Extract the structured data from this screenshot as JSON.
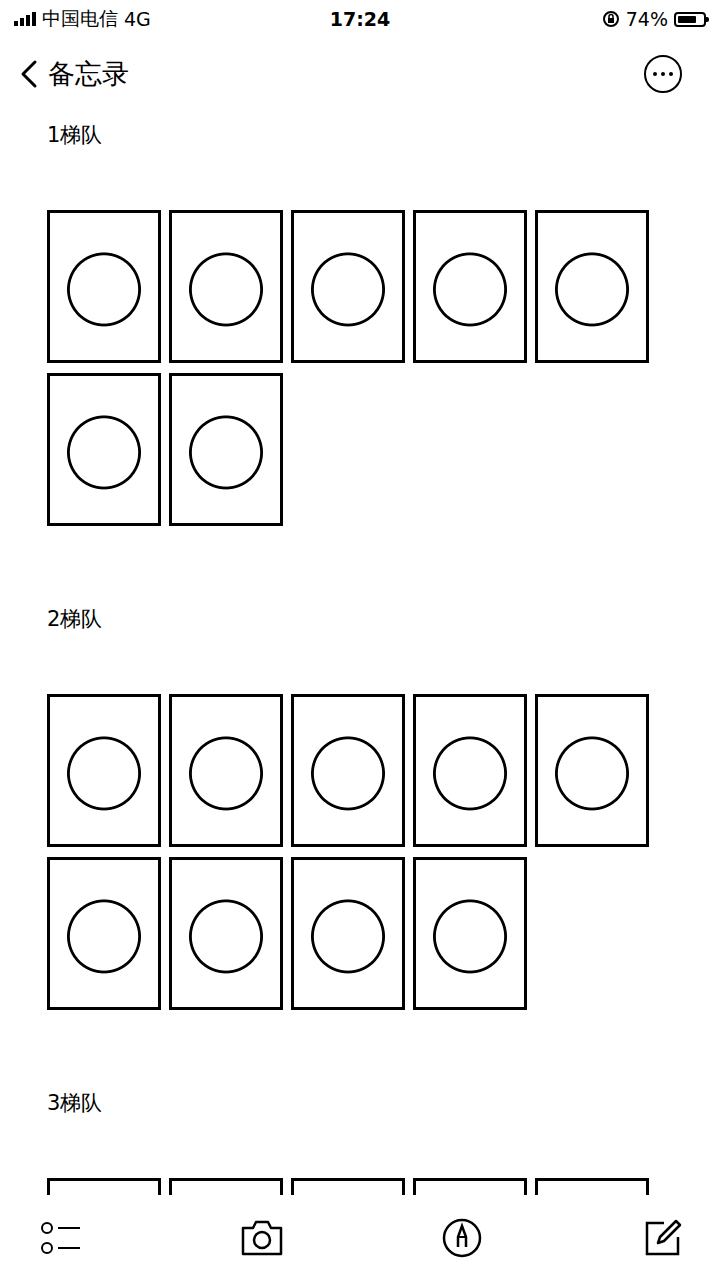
{
  "status_bar": {
    "carrier": "中国电信",
    "network": "4G",
    "time": "17:24",
    "battery": "74%",
    "battery_level": 0.74,
    "signal_bars": 4
  },
  "nav": {
    "back": "备忘录"
  },
  "sections": [
    {
      "title": "1梯队",
      "photo_count": 7
    },
    {
      "title": "2梯队",
      "photo_count": 9
    },
    {
      "title": "3梯队",
      "photo_count": 5
    }
  ]
}
